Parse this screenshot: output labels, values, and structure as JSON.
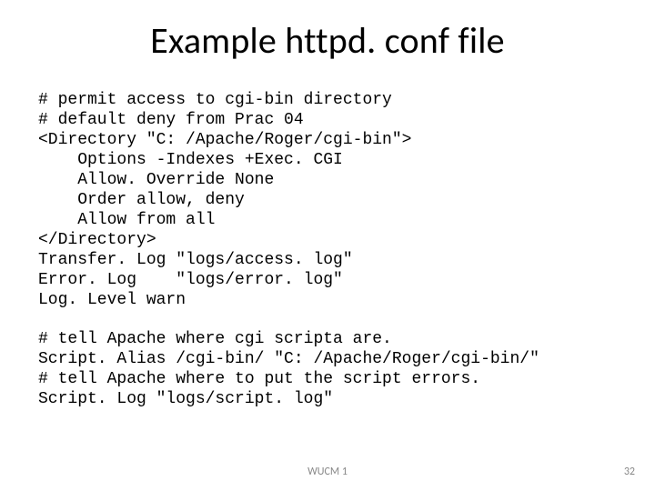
{
  "title": "Example httpd. conf file",
  "code": "# permit access to cgi-bin directory\n# default deny from Prac 04\n<Directory \"C: /Apache/Roger/cgi-bin\">\n    Options -Indexes +Exec. CGI\n    Allow. Override None\n    Order allow, deny\n    Allow from all\n</Directory>\nTransfer. Log \"logs/access. log\"\nError. Log    \"logs/error. log\"\nLog. Level warn\n\n# tell Apache where cgi scripta are.\nScript. Alias /cgi-bin/ \"C: /Apache/Roger/cgi-bin/\"\n# tell Apache where to put the script errors.\nScript. Log \"logs/script. log\"",
  "footer": {
    "center": "WUCM 1",
    "page": "32"
  }
}
